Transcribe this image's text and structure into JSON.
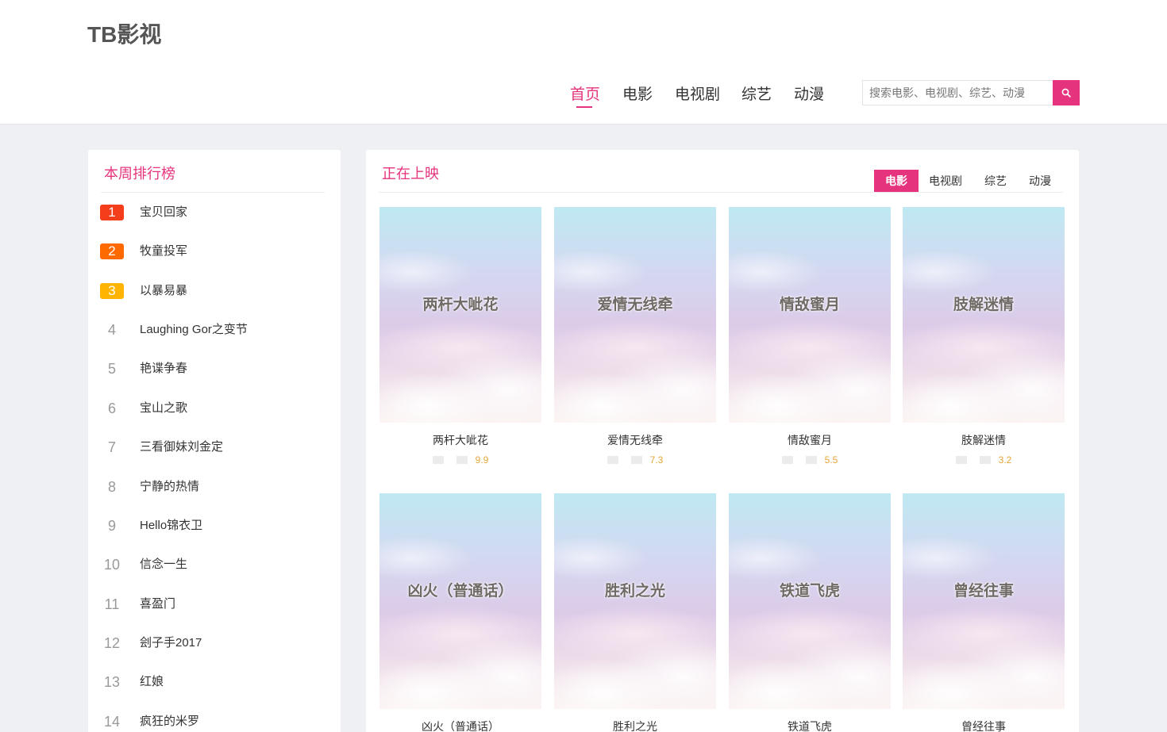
{
  "site": {
    "logo": "TB影视"
  },
  "nav": {
    "items": [
      {
        "label": "首页",
        "active": true
      },
      {
        "label": "电影"
      },
      {
        "label": "电视剧"
      },
      {
        "label": "综艺"
      },
      {
        "label": "动漫"
      }
    ]
  },
  "search": {
    "placeholder": "搜索电影、电视剧、综艺、动漫",
    "value": "",
    "icon": "search-icon"
  },
  "ranking": {
    "title": "本周排行榜",
    "top_colors": [
      "#f33d1b",
      "#ff6a00",
      "#ffb400"
    ],
    "items": [
      {
        "rank": "1",
        "name": "宝贝回家"
      },
      {
        "rank": "2",
        "name": "牧童投军"
      },
      {
        "rank": "3",
        "name": "以暴易暴"
      },
      {
        "rank": "4",
        "name": "Laughing Gor之变节"
      },
      {
        "rank": "5",
        "name": "艳谍争春"
      },
      {
        "rank": "6",
        "name": "宝山之歌"
      },
      {
        "rank": "7",
        "name": "三看御妹刘金定"
      },
      {
        "rank": "8",
        "name": "宁静的热情"
      },
      {
        "rank": "9",
        "name": "Hello锦衣卫"
      },
      {
        "rank": "10",
        "name": "信念一生"
      },
      {
        "rank": "11",
        "name": "喜盈门"
      },
      {
        "rank": "12",
        "name": "刽子手2017"
      },
      {
        "rank": "13",
        "name": "红娘"
      },
      {
        "rank": "14",
        "name": "疯狂的米罗"
      }
    ]
  },
  "now_showing": {
    "title": "正在上映",
    "accent": "#e5347d",
    "tabs": [
      {
        "label": "电影",
        "active": true
      },
      {
        "label": "电视剧"
      },
      {
        "label": "综艺"
      },
      {
        "label": "动漫"
      }
    ],
    "cards": [
      {
        "poster_text": "两杆大呲花",
        "title": "两杆大呲花",
        "score": "9.9"
      },
      {
        "poster_text": "爱情无线牵",
        "title": "爱情无线牵",
        "score": "7.3"
      },
      {
        "poster_text": "情敌蜜月",
        "title": "情敌蜜月",
        "score": "5.5"
      },
      {
        "poster_text": "肢解迷情",
        "title": "肢解迷情",
        "score": "3.2"
      },
      {
        "poster_text": "凶火（普通话）",
        "title": "凶火（普通话）",
        "score": ""
      },
      {
        "poster_text": "胜利之光",
        "title": "胜利之光",
        "score": ""
      },
      {
        "poster_text": "铁道飞虎",
        "title": "铁道飞虎",
        "score": ""
      },
      {
        "poster_text": "曾经往事",
        "title": "曾经往事",
        "score": ""
      }
    ]
  }
}
